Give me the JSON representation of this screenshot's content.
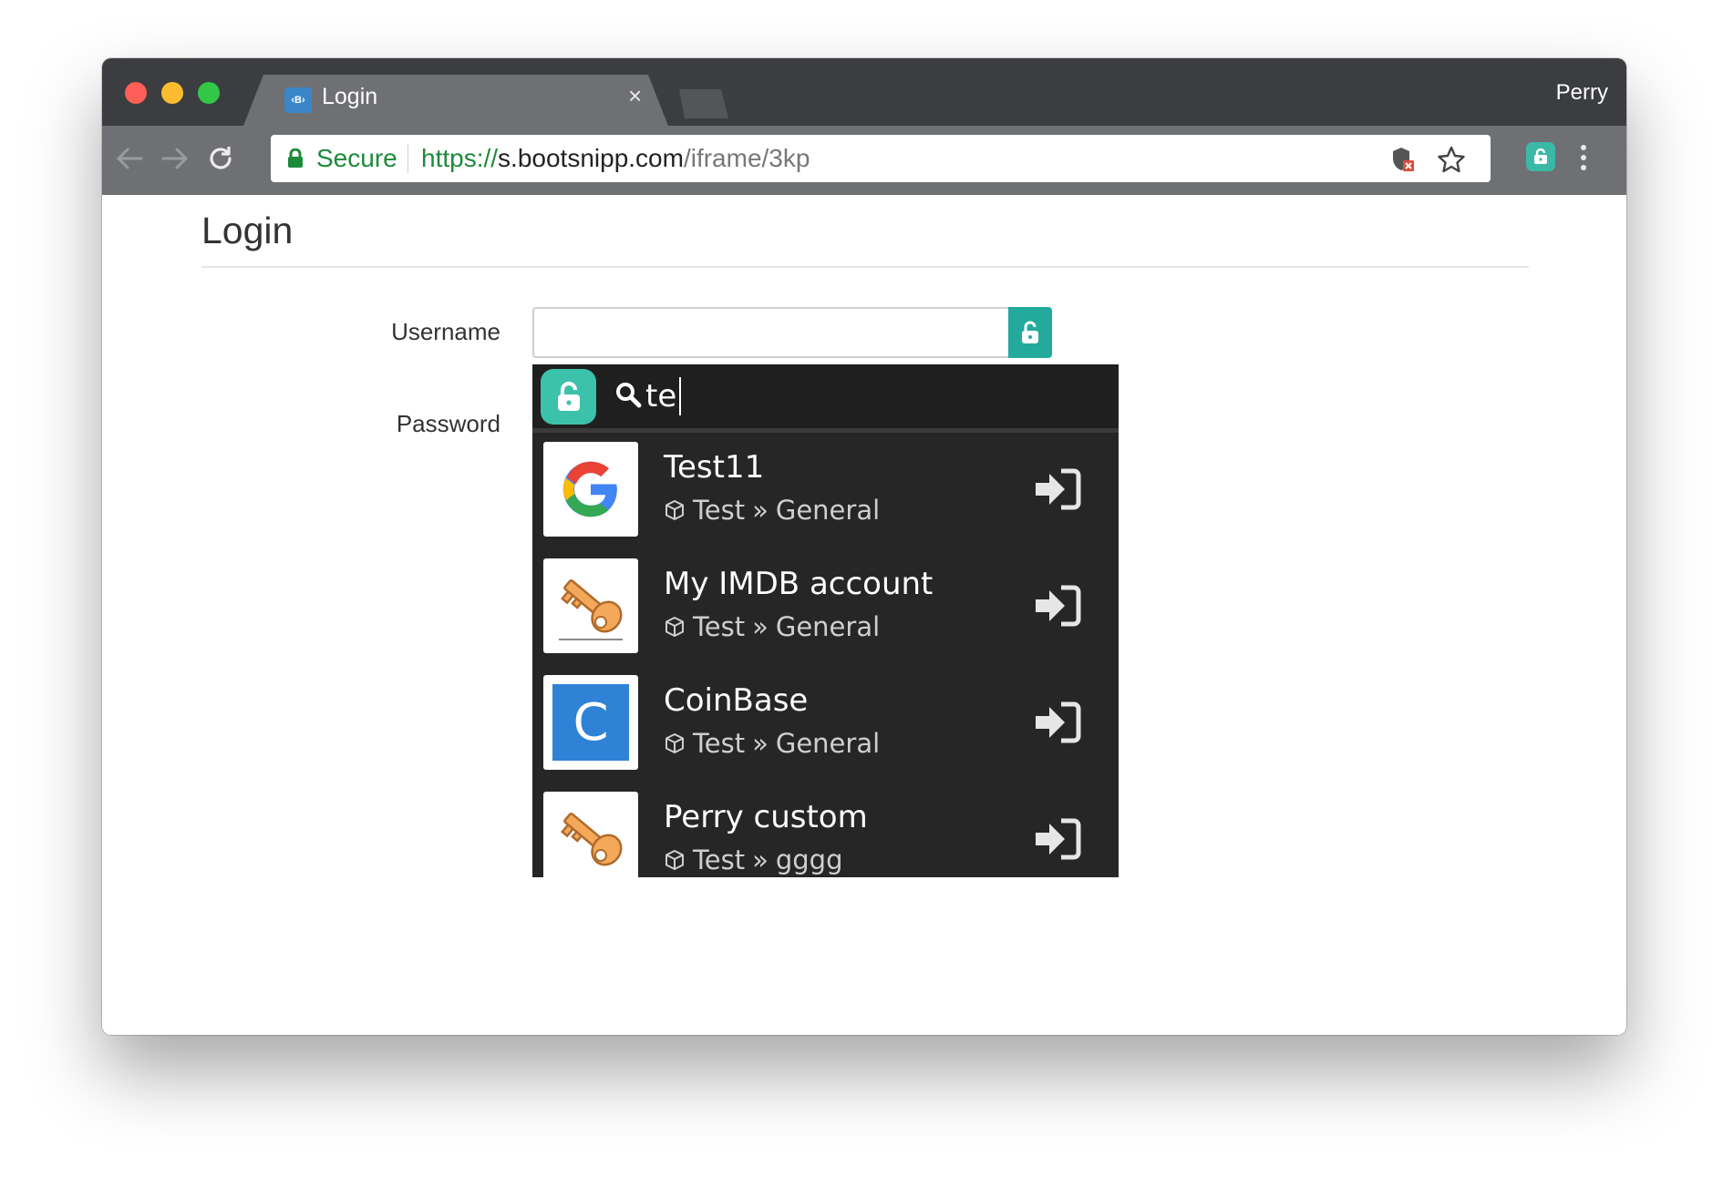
{
  "browser": {
    "tab_title": "Login",
    "tab_close": "×",
    "favicon_text": "‹B›",
    "profile_name": "Perry",
    "secure_label": "Secure",
    "url_scheme": "https://",
    "url_host": "s.bootsnipp.com",
    "url_path": "/iframe/3kp",
    "accent": "#3bb9a6"
  },
  "page": {
    "title": "Login",
    "username_label": "Username",
    "password_label": "Password",
    "username_value": ""
  },
  "popup": {
    "search_query": "te",
    "results": [
      {
        "title": "Test11",
        "vault": "Test",
        "separator": "»",
        "folder": "General",
        "icon": "google-logo-icon"
      },
      {
        "title": "My IMDB account",
        "vault": "Test",
        "separator": "»",
        "folder": "General",
        "icon": "key-icon"
      },
      {
        "title": "CoinBase",
        "vault": "Test",
        "separator": "»",
        "folder": "General",
        "icon": "coinbase-icon"
      },
      {
        "title": "Perry custom",
        "vault": "Test",
        "separator": "»",
        "folder": "gggg",
        "icon": "key-icon"
      }
    ]
  }
}
